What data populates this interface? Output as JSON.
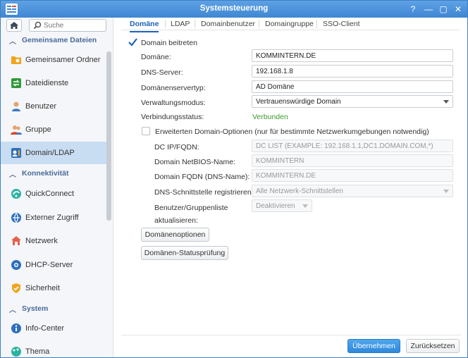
{
  "window": {
    "title": "Systemsteuerung",
    "controls": {
      "help": "?",
      "minimize": "—",
      "maximize": "▢",
      "close": "✕"
    }
  },
  "sidebar": {
    "search_placeholder": "Suche",
    "sections": [
      {
        "label": "Gemeinsame Dateien"
      },
      {
        "label": "Konnektivität"
      },
      {
        "label": "System"
      }
    ],
    "items": [
      {
        "label": "Gemeinsamer Ordner",
        "icon": "shared-folder-icon"
      },
      {
        "label": "Dateidienste",
        "icon": "file-services-icon"
      },
      {
        "label": "Benutzer",
        "icon": "user-icon"
      },
      {
        "label": "Gruppe",
        "icon": "group-icon"
      },
      {
        "label": "Domain/LDAP",
        "icon": "domain-ldap-icon",
        "active": true
      },
      {
        "label": "QuickConnect",
        "icon": "quickconnect-icon"
      },
      {
        "label": "Externer Zugriff",
        "icon": "external-access-icon"
      },
      {
        "label": "Netzwerk",
        "icon": "network-icon"
      },
      {
        "label": "DHCP-Server",
        "icon": "dhcp-server-icon"
      },
      {
        "label": "Sicherheit",
        "icon": "security-icon"
      },
      {
        "label": "Info-Center",
        "icon": "info-center-icon"
      },
      {
        "label": "Thema",
        "icon": "theme-icon"
      }
    ]
  },
  "tabs": [
    "Domäne",
    "LDAP",
    "Domainbenutzer",
    "Domaingruppe",
    "SSO-Client"
  ],
  "form": {
    "join_domain_label": "Domain beitreten",
    "join_domain_checked": true,
    "domain_label": "Domäne:",
    "domain_value": "KOMMINTERN.DE",
    "dns_label": "DNS-Server:",
    "dns_value": "192.168.1.8",
    "server_type_label": "Domänenservertyp:",
    "server_type_value": "AD Domäne",
    "mgmt_mode_label": "Verwaltungsmodus:",
    "mgmt_mode_value": "Vertrauenswürdige Domain",
    "conn_status_label": "Verbindungsstatus:",
    "conn_status_value": "Verbunden",
    "advanced_label": "Erweiterten Domain-Optionen (nur für bestimmte Netzwerkumgebungen notwendig)",
    "advanced_checked": false,
    "dc_label": "DC IP/FQDN:",
    "dc_placeholder": "DC LIST (EXAMPLE: 192.168.1.1,DC1.DOMAIN.COM,*)",
    "netbios_label": "Domain NetBIOS-Name:",
    "netbios_value": "KOMMINTERN",
    "fqdn_label": "Domain FQDN (DNS-Name):",
    "fqdn_value": "KOMMINTERN.DE",
    "dns_iface_label": "DNS-Schnittstelle registrieren:",
    "dns_iface_value": "Alle Netzwerk-Schnittstellen",
    "userlist_label_1": "Benutzer/Gruppenliste",
    "userlist_label_2": "aktualisieren:",
    "userlist_value": "Deaktivieren",
    "domain_options_button": "Domänenoptionen",
    "status_check_button": "Domänen-Statusprüfung"
  },
  "footer": {
    "apply": "Übernehmen",
    "reset": "Zurücksetzen"
  },
  "colors": {
    "accent": "#1c63b8",
    "titlebar": "#4a91dc",
    "status_ok": "#3d9b2f"
  }
}
